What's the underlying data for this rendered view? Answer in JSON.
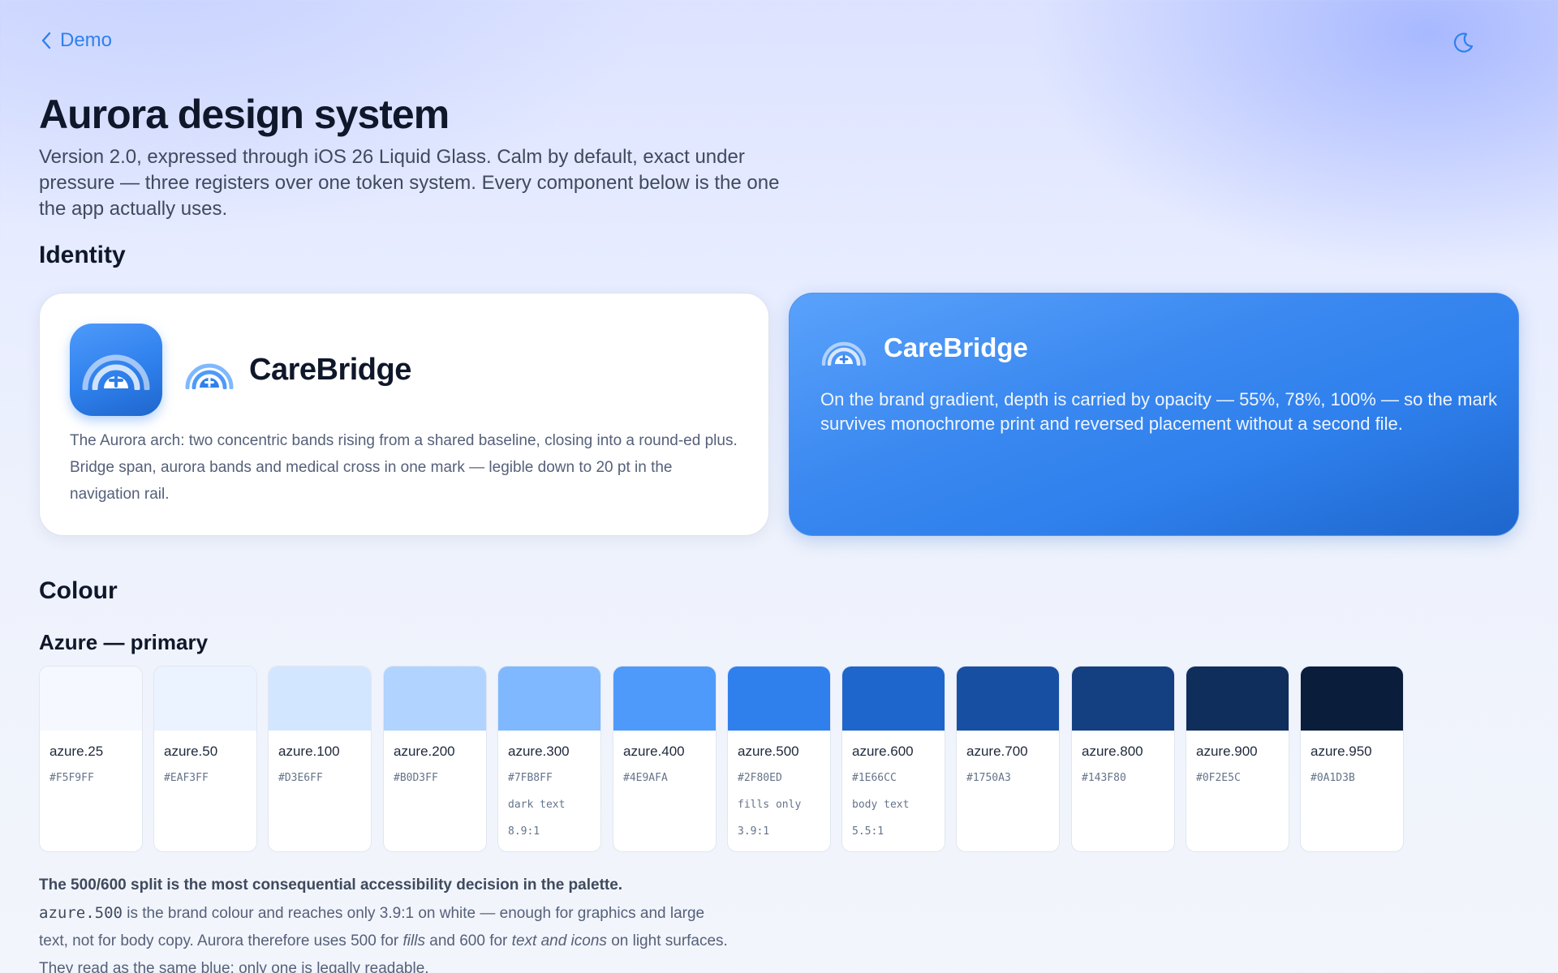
{
  "nav": {
    "back_label": "Demo"
  },
  "header": {
    "title": "Aurora design system",
    "intro": "Version 2.0, expressed through iOS 26 Liquid Glass. Calm by default, exact under pressure — three registers over one token system. Every component below is the one the app actually uses."
  },
  "identity": {
    "heading": "Identity",
    "light_card": {
      "brand": "CareBridge",
      "body": "The Aurora arch: two concentric bands rising from a shared baseline, closing into a round-ed plus. Bridge span, aurora bands and medical cross in one mark — legible down to 20 pt in the navigation rail."
    },
    "brand_card": {
      "brand": "CareBridge",
      "body": "On the brand gradient, depth is carried by opacity — 55%, 78%, 100% — so the mark survives monochrome print and reversed placement without a second file."
    }
  },
  "colour": {
    "heading": "Colour",
    "subheading": "Azure — primary",
    "swatches": [
      {
        "name": "azure.25",
        "hex": "#F5F9FF",
        "color": "#F5F9FF",
        "note": "",
        "ratio": ""
      },
      {
        "name": "azure.50",
        "hex": "#EAF3FF",
        "color": "#EAF3FF",
        "note": "",
        "ratio": ""
      },
      {
        "name": "azure.100",
        "hex": "#D3E6FF",
        "color": "#D3E6FF",
        "note": "",
        "ratio": ""
      },
      {
        "name": "azure.200",
        "hex": "#B0D3FF",
        "color": "#B0D3FF",
        "note": "",
        "ratio": ""
      },
      {
        "name": "azure.300",
        "hex": "#7FB8FF",
        "color": "#7FB8FF",
        "note": "dark text",
        "ratio": "8.9:1"
      },
      {
        "name": "azure.400",
        "hex": "#4E9AFA",
        "color": "#4E9AFA",
        "note": "",
        "ratio": ""
      },
      {
        "name": "azure.500",
        "hex": "#2F80ED",
        "color": "#2F80ED",
        "note": "fills only",
        "ratio": "3.9:1"
      },
      {
        "name": "azure.600",
        "hex": "#1E66CC",
        "color": "#1E66CC",
        "note": "body text",
        "ratio": "5.5:1"
      },
      {
        "name": "azure.700",
        "hex": "#1750A3",
        "color": "#1750A3",
        "note": "",
        "ratio": ""
      },
      {
        "name": "azure.800",
        "hex": "#143F80",
        "color": "#143F80",
        "note": "",
        "ratio": ""
      },
      {
        "name": "azure.900",
        "hex": "#0F2E5C",
        "color": "#0F2E5C",
        "note": "",
        "ratio": ""
      },
      {
        "name": "azure.950",
        "hex": "#0A1D3B",
        "color": "#0A1D3B",
        "note": "",
        "ratio": ""
      }
    ],
    "footnote": {
      "lead": "The 500/600 split is the most consequential accessibility decision in the palette.",
      "code": "azure.500",
      "text_1": " is the brand colour and reaches only 3.9:1 on white — enough for graphics and large text, not for body copy. Aurora therefore uses 500 for ",
      "em_1": "fills",
      "text_2": " and 600 for ",
      "em_2": "text and icons",
      "text_3": " on light surfaces. They read as the same blue; only one is legally readable."
    }
  },
  "icons": {
    "back": "chevron-left-icon",
    "theme": "moon-icon",
    "logo": "aurora-arch-icon"
  },
  "colors": {
    "accent": "#2F80ED",
    "accent_dark": "#1E66CC",
    "ink": "#0F172A"
  }
}
